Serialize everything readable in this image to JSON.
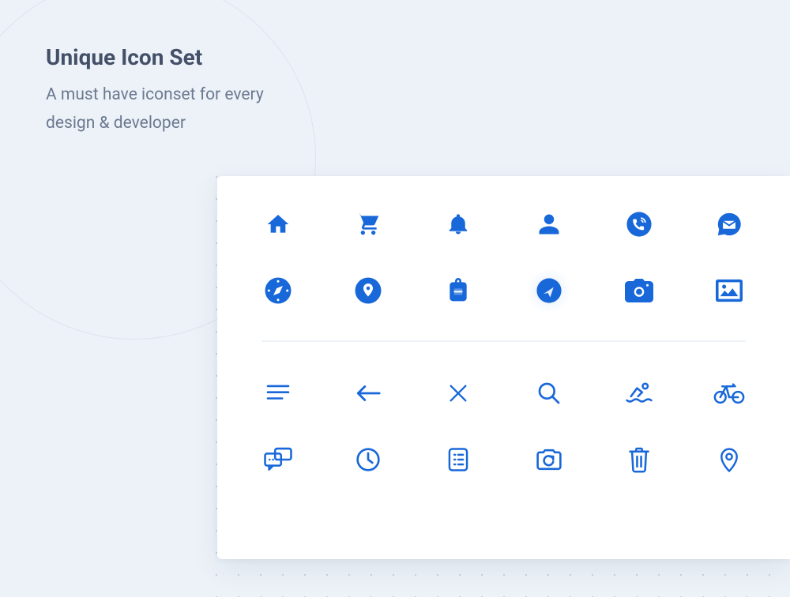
{
  "header": {
    "title": "Unique Icon Set",
    "subtitle_line1": "A must have iconset for every",
    "subtitle_line2": "design & developer"
  },
  "colors": {
    "icon": "#1868da",
    "background": "#edf2f8",
    "panel": "#ffffff",
    "title": "#445068",
    "subtitle": "#6b7a90"
  },
  "icons": {
    "row1": [
      "home",
      "cart",
      "bell",
      "user",
      "phone-circle",
      "mail-bubble"
    ],
    "row2": [
      "compass-circle",
      "pin-circle",
      "backpack",
      "navigate-circle",
      "camera",
      "image"
    ],
    "row3": [
      "align-left",
      "arrow-left",
      "close",
      "search",
      "swim",
      "bicycle"
    ],
    "row4": [
      "chat",
      "clock",
      "list-note",
      "camera-sync",
      "trash",
      "location-pin"
    ]
  }
}
